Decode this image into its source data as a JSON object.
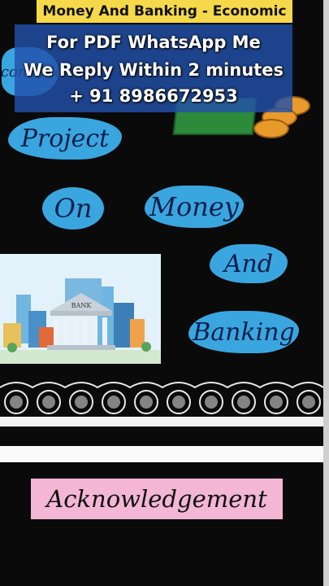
{
  "banner": {
    "title": "Money And Banking - Economic"
  },
  "overlay": {
    "line1": "For PDF WhatsApp Me",
    "line2": "We Reply Within 2 minutes",
    "line3": "+ 91 8986672953"
  },
  "board": {
    "word_economics": "Economics",
    "word_project": "Project",
    "word_on": "On",
    "word_money": "Money",
    "word_and": "And",
    "word_banking": "Banking",
    "bank_sign": "BANK"
  },
  "page2": {
    "heading": "Acknowledgement"
  },
  "colors": {
    "banner": "#f5d94a",
    "cloud": "#3aa6e0",
    "pink": "#f3b6d4",
    "overlay": "#2250aa"
  }
}
